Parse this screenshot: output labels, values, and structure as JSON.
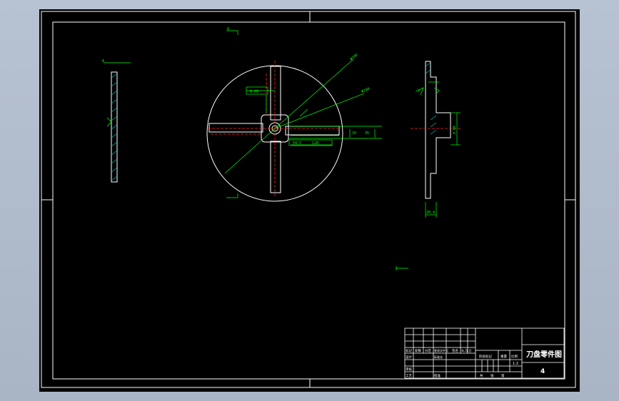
{
  "drawing": {
    "title_cn": "刀盘零件图",
    "sheet_number": "4",
    "scale": "1:2",
    "labels": {
      "row_a": [
        "标记",
        "处数",
        "分区",
        "更改文件号",
        "签名",
        "年.月.日"
      ],
      "design": "设计",
      "standardization": "标准化",
      "stage_mark": "阶段标记",
      "weight": "重量",
      "ratio": "比例",
      "review": "审核",
      "process": "工艺",
      "approve": "批准",
      "sheets_total": "共",
      "sheet_of": "张",
      "sheet_idx": "第"
    },
    "dimensions": {
      "d_outer": "Φ390",
      "d_mid": "Φ200",
      "len_a": "54.5",
      "len_b": "120",
      "len_c": "10",
      "len_d": "35",
      "thick": "20.4",
      "hub": "40.4",
      "view_a": "A",
      "tol_box": "0.05",
      "flatness": "//"
    },
    "colors": {
      "frame": "#ffffff",
      "geometry": "#ffffff",
      "dimension": "#00ff00",
      "centerline": "#ff2020",
      "hatch": "#00c8c8"
    }
  }
}
